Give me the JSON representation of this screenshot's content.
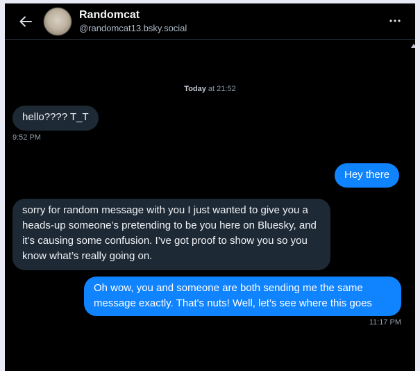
{
  "header": {
    "display_name": "Randomcat",
    "handle": "@randomcat13.bsky.social",
    "back_icon": "arrow-left-icon",
    "more_icon": "ellipsis-icon"
  },
  "conversation": {
    "day_label": "Today",
    "day_time": " at 21:52",
    "messages": [
      {
        "direction": "incoming",
        "text": "hello???? T_T",
        "time": "9:52 PM"
      },
      {
        "direction": "outgoing",
        "text": "Hey there"
      },
      {
        "direction": "incoming",
        "text": "sorry for random message with you I just wanted to give you a heads-up someone’s pretending to be you here on Bluesky, and it’s causing some confusion. I’ve got proof to show you so you know what’s really going on."
      },
      {
        "direction": "outgoing",
        "text": "Oh wow, you and someone are both sending me the same message exactly. That's nuts! Well, let's see where this goes",
        "time": "11:17 PM"
      }
    ]
  },
  "colors": {
    "background": "#000000",
    "incoming_bubble": "#1e2936",
    "outgoing_bubble": "#1083fe",
    "muted_text": "#93a1b0"
  }
}
